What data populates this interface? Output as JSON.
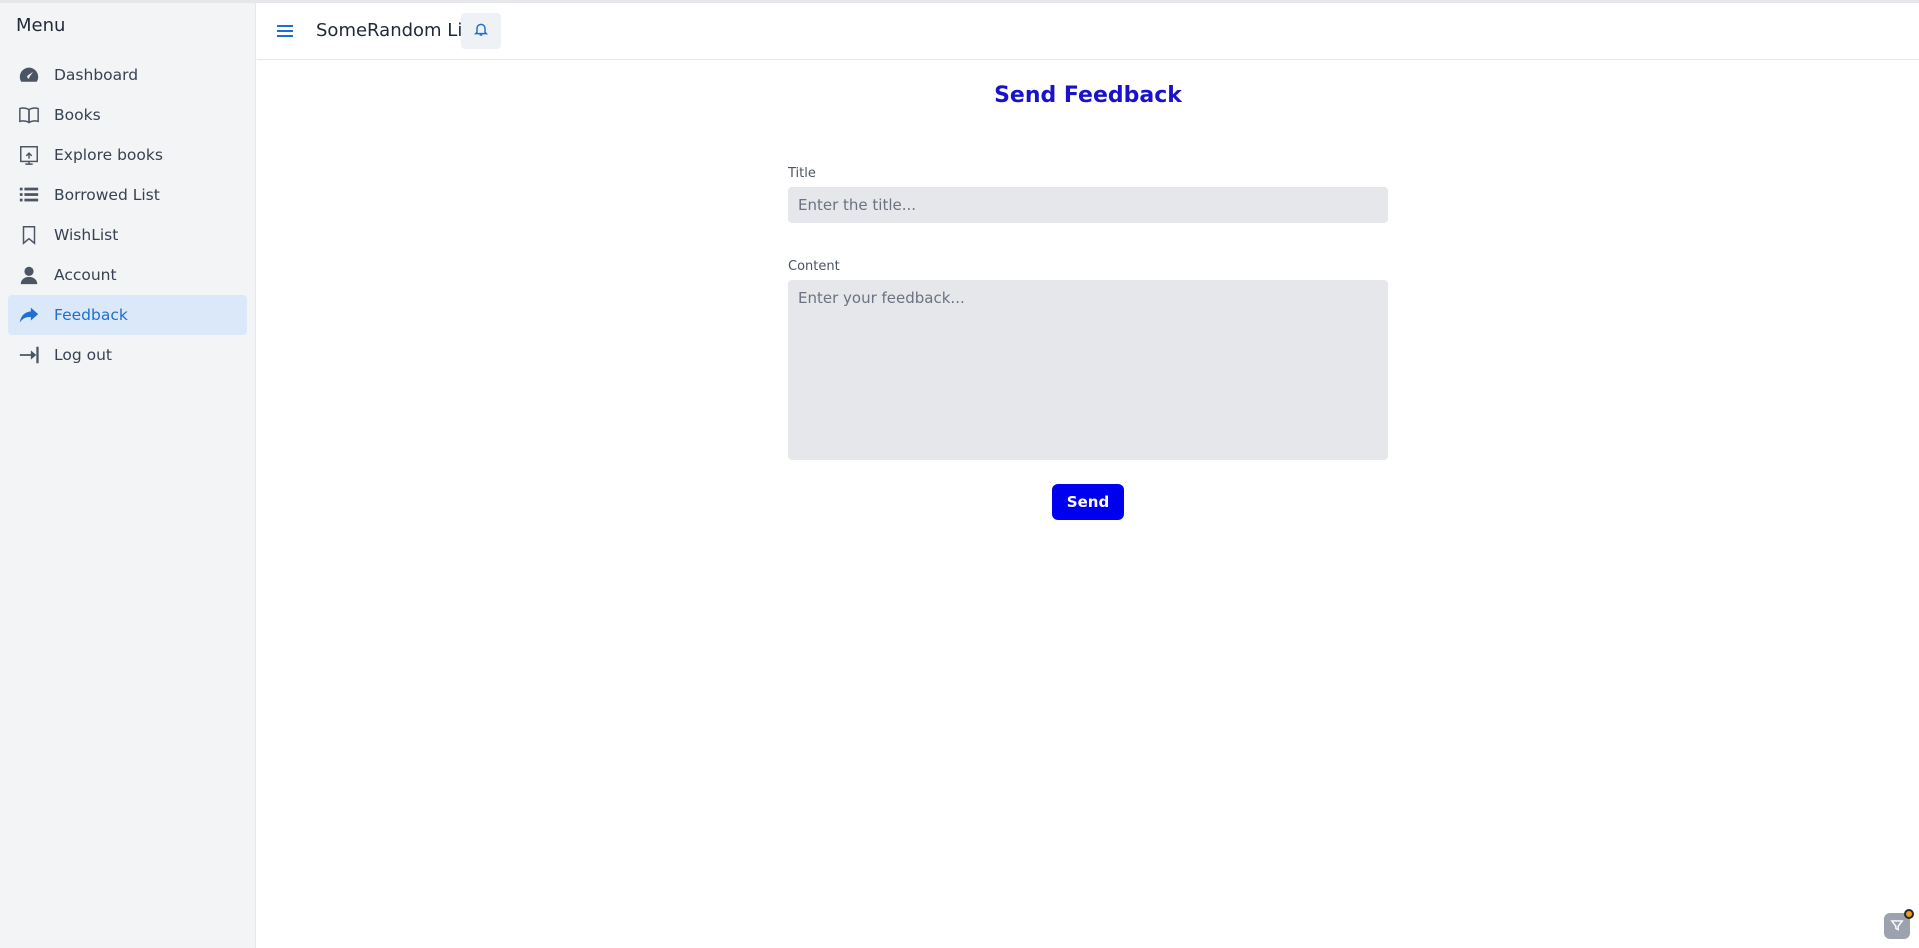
{
  "sidebar": {
    "title": "Menu",
    "items": [
      {
        "label": "Dashboard",
        "icon": "dashboard-gauge-icon",
        "active": false
      },
      {
        "label": "Books",
        "icon": "open-book-icon",
        "active": false
      },
      {
        "label": "Explore books",
        "icon": "explore-icon",
        "active": false
      },
      {
        "label": "Borrowed List",
        "icon": "list-icon",
        "active": false
      },
      {
        "label": "WishList",
        "icon": "bookmark-icon",
        "active": false
      },
      {
        "label": "Account",
        "icon": "user-icon",
        "active": false
      },
      {
        "label": "Feedback",
        "icon": "share-arrow-icon",
        "active": true
      },
      {
        "label": "Log out",
        "icon": "logout-icon",
        "active": false
      }
    ]
  },
  "header": {
    "app_title": "SomeRandom Lib",
    "menu_icon": "hamburger-icon",
    "notification_icon": "bell-icon"
  },
  "main": {
    "page_title": "Send Feedback",
    "form": {
      "title_label": "Title",
      "title_placeholder": "Enter the title...",
      "title_value": "",
      "content_label": "Content",
      "content_placeholder": "Enter your feedback...",
      "content_value": "",
      "send_label": "Send"
    }
  },
  "colors": {
    "accent": "#1d6fd1",
    "page_title": "#1a12c9",
    "send_button": "#0000f0",
    "active_item_bg": "#dbe8f9",
    "sidebar_bg": "#f3f4f6",
    "input_bg": "#e5e7eb"
  }
}
